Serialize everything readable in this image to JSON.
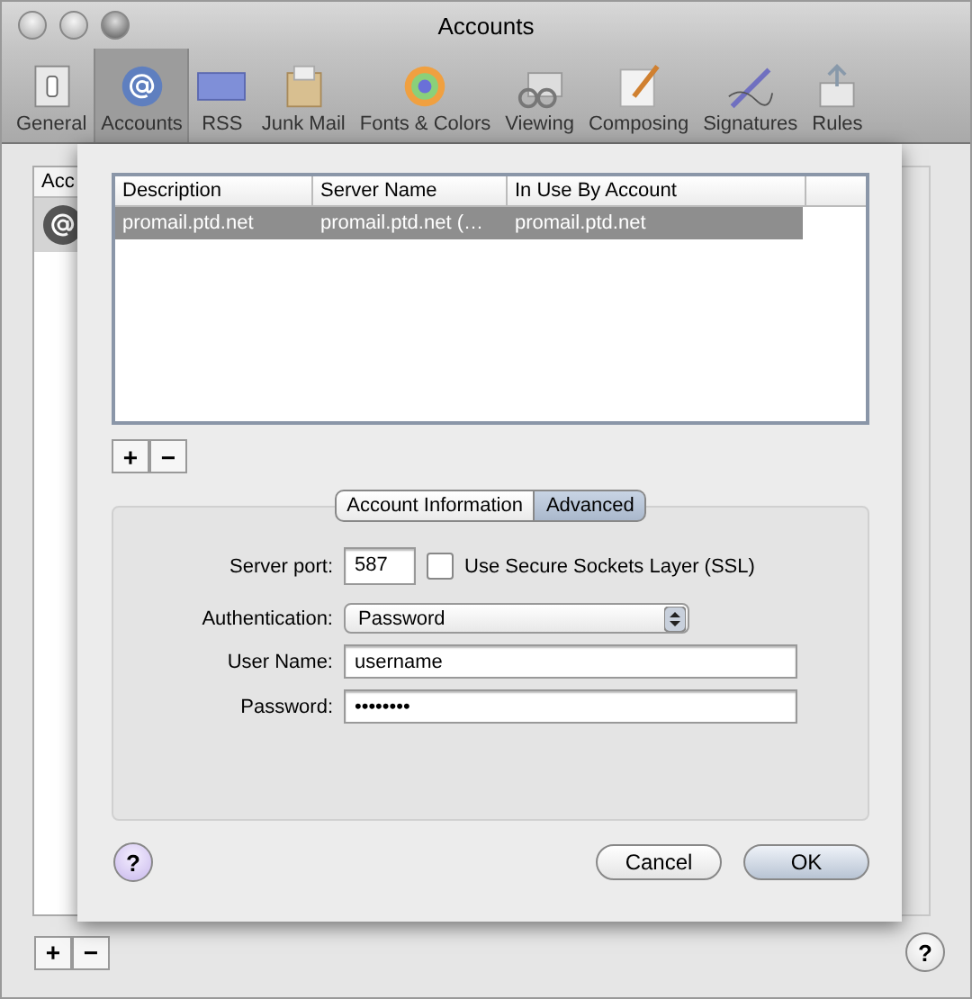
{
  "window": {
    "title": "Accounts"
  },
  "toolbar": {
    "items": [
      {
        "label": "General",
        "selected": false
      },
      {
        "label": "Accounts",
        "selected": true
      },
      {
        "label": "RSS",
        "selected": false
      },
      {
        "label": "Junk Mail",
        "selected": false
      },
      {
        "label": "Fonts & Colors",
        "selected": false
      },
      {
        "label": "Viewing",
        "selected": false
      },
      {
        "label": "Composing",
        "selected": false
      },
      {
        "label": "Signatures",
        "selected": false
      },
      {
        "label": "Rules",
        "selected": false
      }
    ]
  },
  "accounts_list": {
    "header": "Acc",
    "add": "+",
    "remove": "−",
    "help": "?"
  },
  "sheet": {
    "table": {
      "columns": [
        "Description",
        "Server Name",
        "In Use By Account"
      ],
      "rows": [
        {
          "cells": [
            "promail.ptd.net",
            "promail.ptd.net (…",
            "promail.ptd.net"
          ],
          "selected": true
        }
      ]
    },
    "add": "+",
    "remove": "−",
    "tabs": [
      {
        "label": "Account Information",
        "selected": false
      },
      {
        "label": "Advanced",
        "selected": true
      }
    ],
    "server_port": {
      "label": "Server port:",
      "value": "587"
    },
    "ssl": {
      "label": "Use Secure Sockets Layer (SSL)",
      "checked": false
    },
    "authentication": {
      "label": "Authentication:",
      "value": "Password"
    },
    "user_name": {
      "label": "User Name:",
      "value": "username"
    },
    "password": {
      "label": "Password:",
      "value": "••••••••"
    },
    "help": "?",
    "buttons": [
      {
        "label": "Cancel",
        "kind": "normal"
      },
      {
        "label": "OK",
        "kind": "default"
      }
    ]
  }
}
